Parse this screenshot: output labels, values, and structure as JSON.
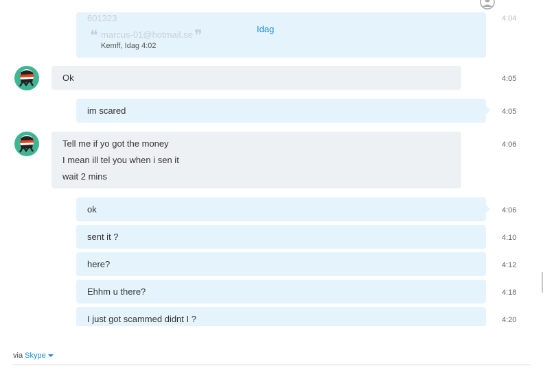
{
  "header": {
    "day_label": "Idag"
  },
  "quoted": {
    "line1": "601323",
    "email": "marcus-01@hotmail.se",
    "meta": "Kemff, Idag 4:02",
    "time": "4:04"
  },
  "messages": [
    {
      "direction": "in",
      "lines": [
        "Ok"
      ],
      "time": "4:05"
    },
    {
      "direction": "out",
      "lines": [
        "im scared"
      ],
      "time": "4:05"
    },
    {
      "direction": "in",
      "lines": [
        "Tell me if yo got the money",
        "I mean ill tel you when i sen it",
        "wait 2 mins"
      ],
      "time": "4:06"
    },
    {
      "direction": "out",
      "lines": [
        "ok"
      ],
      "time": "4:06"
    },
    {
      "direction": "out",
      "lines": [
        "sent it ?"
      ],
      "time": "4:10"
    },
    {
      "direction": "out",
      "lines": [
        "here?"
      ],
      "time": "4:12"
    },
    {
      "direction": "out",
      "lines": [
        "Ehhm u there?"
      ],
      "time": "4:18"
    },
    {
      "direction": "out",
      "lines": [
        "I just got scammed didnt I ?"
      ],
      "time": "4:20"
    }
  ],
  "footer": {
    "via": "via",
    "service": "Skype"
  },
  "colors": {
    "incoming_bubble": "#eef1f4",
    "outgoing_bubble": "#e5f4fc",
    "link": "#1a8ad4",
    "avatar_bg": "#3fb594"
  },
  "icons": {
    "avatar": "ninja-avatar-icon",
    "top_right": "user-status-icon",
    "dropdown": "caret-down-icon"
  }
}
